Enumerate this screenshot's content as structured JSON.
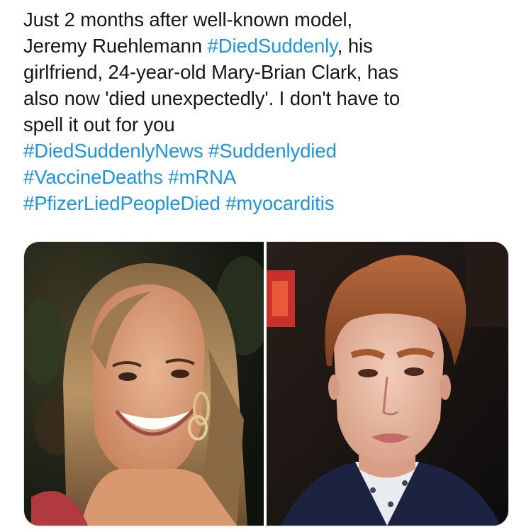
{
  "tweet": {
    "lines": [
      [
        {
          "text": "Just 2 months after well-known model,"
        }
      ],
      [
        {
          "text": "Jeremy Ruehlemann "
        },
        {
          "text": "#DiedSuddenly",
          "hashtag": true
        },
        {
          "text": ", his"
        }
      ],
      [
        {
          "text": "girlfriend, 24-year-old Mary-Brian Clark, has"
        }
      ],
      [
        {
          "text": "also now 'died unexpectedly'. I don't have to"
        }
      ],
      [
        {
          "text": "spell it out for you"
        }
      ],
      [
        {
          "text": "#DiedSuddenlyNews",
          "hashtag": true
        },
        {
          "text": " "
        },
        {
          "text": "#Suddenlydied",
          "hashtag": true
        }
      ],
      [
        {
          "text": "#VaccineDeaths",
          "hashtag": true
        },
        {
          "text": " "
        },
        {
          "text": "#mRNA",
          "hashtag": true
        }
      ],
      [
        {
          "text": "#PfizerLiedPeopleDied",
          "hashtag": true
        },
        {
          "text": " "
        },
        {
          "text": "#myocarditis",
          "hashtag": true
        }
      ]
    ]
  },
  "media": {
    "photos": [
      {
        "subject": "smiling young woman with long hair and hoop earring, dark leafy background"
      },
      {
        "subject": "young man with styled auburn hair, earring, dark patterned jacket, red sign in background"
      }
    ]
  },
  "colors": {
    "text": "#14171a",
    "hashtag": "#1b95e0",
    "media_border": "#dfe4e8"
  }
}
